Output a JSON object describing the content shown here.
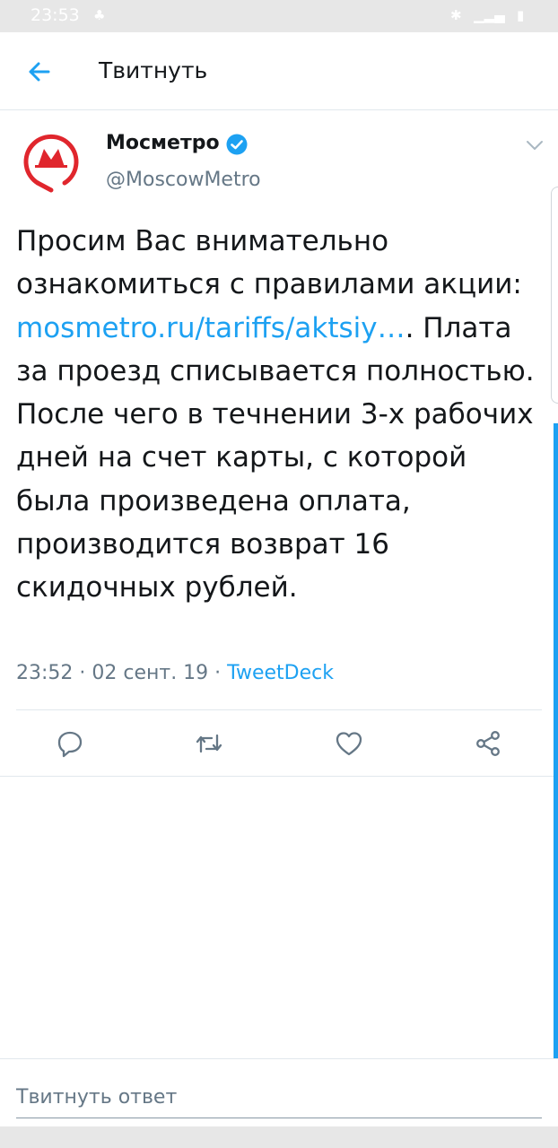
{
  "status_bar": {
    "time": "23:53"
  },
  "app_bar": {
    "title": "Твитнуть"
  },
  "tweet": {
    "author_name": "Мосметро",
    "author_handle": "@MoscowMetro",
    "text_before_link": "Просим Вас внимательно ознакомиться с правилами акции: ",
    "link_text": "mosmetro.ru/tariffs/aktsiy…",
    "text_after_link": ". Плата за проезд списывается полностью. После чего в течнении 3-х рабочих дней на счет карты, с которой была произведена оплата, производится возврат 16 скидочных рублей.",
    "timestamp": "23:52 · 02 сент. 19 · ",
    "source": "TweetDeck"
  },
  "reply": {
    "placeholder": "Твитнуть ответ"
  },
  "colors": {
    "accent": "#1da1f2",
    "brand_red": "#e0262d",
    "muted": "#657786"
  },
  "icons": [
    "back-arrow-icon",
    "verified-icon",
    "chevron-down-icon",
    "reply-icon",
    "retweet-icon",
    "like-icon",
    "share-icon",
    "metro-logo"
  ]
}
